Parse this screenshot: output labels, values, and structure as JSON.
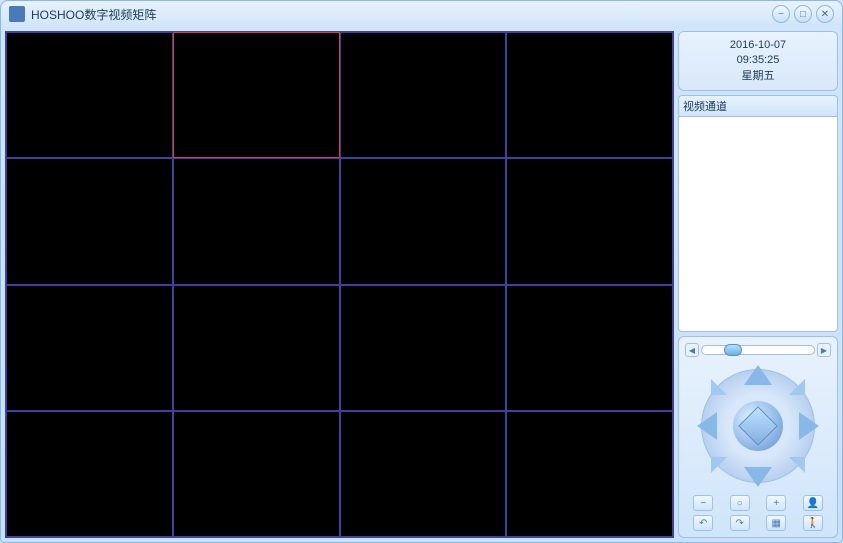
{
  "window": {
    "title": "HOSHOO数字视频矩阵"
  },
  "clock": {
    "date": "2016-10-07",
    "time": "09:35:25",
    "weekday": "星期五"
  },
  "channel": {
    "header": "视频通道"
  },
  "grid": {
    "rows": 4,
    "cols": 4,
    "selected_index": 1
  }
}
